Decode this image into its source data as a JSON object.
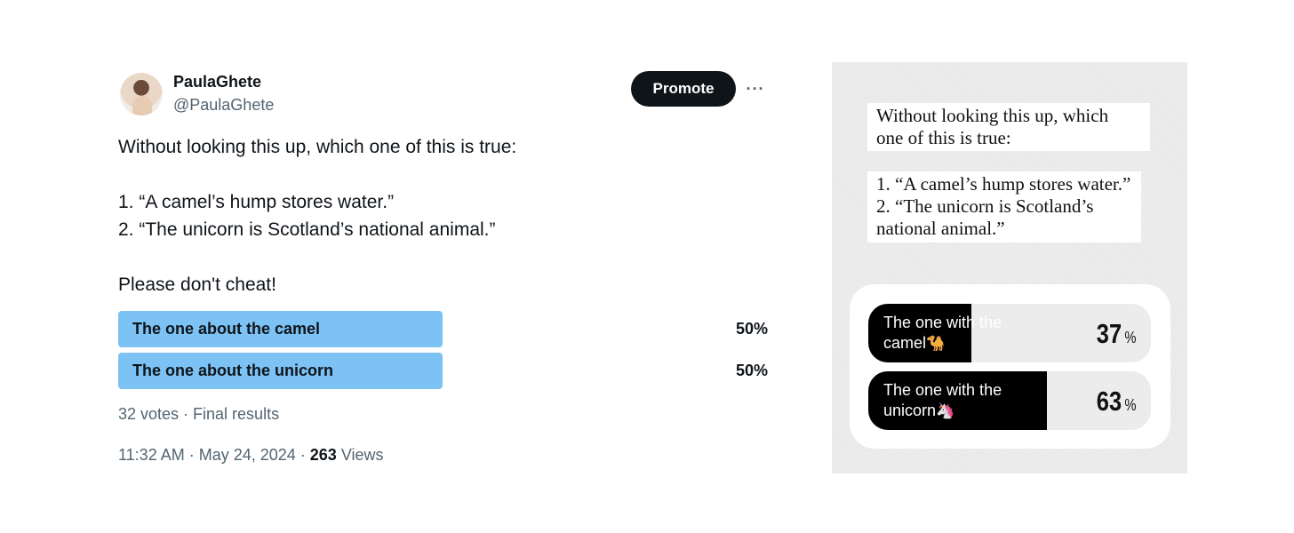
{
  "tweet": {
    "display_name": "PaulaGhete",
    "handle": "@PaulaGhete",
    "promote_label": "Promote",
    "more_label": "···",
    "text_lines": [
      "Without looking this up, which one of this is true:",
      "",
      "1. “A camel’s hump stores water.”",
      "2. “The unicorn is Scotland’s national animal.”",
      "",
      "Please don't cheat!"
    ],
    "poll": {
      "options": [
        {
          "label": "The one about the camel",
          "percent_label": "50%",
          "percent": 50
        },
        {
          "label": "The one about the unicorn",
          "percent_label": "50%",
          "percent": 50
        }
      ],
      "meta": "32 votes · Final results"
    },
    "timestamp": "11:32 AM · May 24, 2024 · ",
    "views_count": "263",
    "views_label": " Views"
  },
  "story": {
    "question_lines": [
      "Without looking this up, which",
      "one of this is true:"
    ],
    "statement_lines": [
      "1. “A camel’s hump stores water.”",
      "2. “The unicorn is Scotland’s",
      "national animal.”"
    ],
    "poll": {
      "options": [
        {
          "label_line1": "The one with the",
          "label_line2": "camel",
          "emoji": "🐪",
          "percent": 37,
          "percent_text": "37",
          "percent_sign": "%"
        },
        {
          "label_line1": "The one with the",
          "label_line2": "unicorn",
          "emoji": "🦄",
          "percent": 63,
          "percent_text": "63",
          "percent_sign": "%"
        }
      ]
    }
  },
  "colors": {
    "poll_bar": "#7cc2f4",
    "promote_bg": "#0f1419",
    "story_fill": "#000000",
    "story_track": "#ececec"
  }
}
